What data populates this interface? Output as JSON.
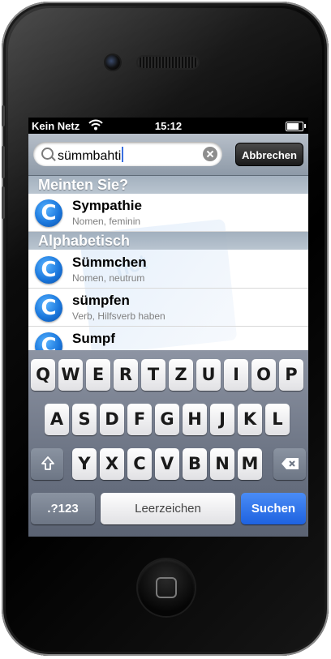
{
  "status_bar": {
    "carrier": "Kein Netz",
    "time": "15:12",
    "battery_level": 0.8,
    "icons": [
      "wifi-icon",
      "battery-icon"
    ]
  },
  "search": {
    "value": "sümmbahti",
    "cancel_label": "Abbrechen",
    "icons": [
      "magnifier-icon",
      "clear-icon"
    ]
  },
  "sections": [
    {
      "header": "Meinten Sie?",
      "items": [
        {
          "title": "Sympathie",
          "subtitle": "Nomen, feminin"
        }
      ]
    },
    {
      "header": "Alphabetisch",
      "items": [
        {
          "title": "Sümmchen",
          "subtitle": "Nomen, neutrum"
        },
        {
          "title": "sümpfen",
          "subtitle": "Verb, Hilfsverb haben"
        },
        {
          "title": "Sumpf",
          "subtitle": ""
        }
      ]
    }
  ],
  "result_icon_letter": "C",
  "keyboard": {
    "row1": [
      "Q",
      "W",
      "E",
      "R",
      "T",
      "Z",
      "U",
      "I",
      "O",
      "P"
    ],
    "row2": [
      "A",
      "S",
      "D",
      "F",
      "G",
      "H",
      "J",
      "K",
      "L"
    ],
    "row3": [
      "Y",
      "X",
      "C",
      "V",
      "B",
      "N",
      "M"
    ],
    "numbers_label": ".?123",
    "space_label": "Leerzeichen",
    "search_label": "Suchen",
    "icons": [
      "shift-icon",
      "backspace-icon"
    ]
  },
  "colors": {
    "accent": "#1e62e0",
    "icon_blue": "#1b78dd"
  }
}
